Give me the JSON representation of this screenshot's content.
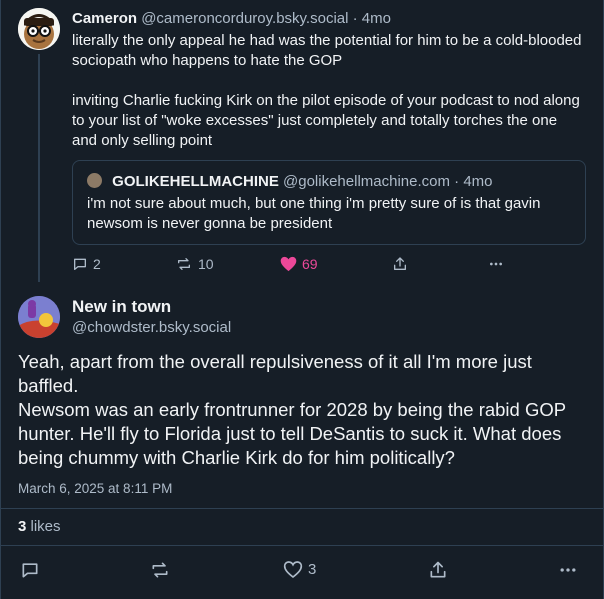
{
  "reply_post": {
    "author_name": "Cameron",
    "author_handle": "@cameroncorduroy.bsky.social",
    "separator": "·",
    "time": "4mo",
    "paragraph_1": "literally the only appeal he had was the potential for him to be a cold-blooded sociopath who happens to hate the GOP",
    "paragraph_2": "inviting Charlie fucking Kirk on the pilot episode of your podcast to nod along to your list of \"woke excesses\" just completely and totally torches the one and only selling point",
    "quote": {
      "author_name": "GOLIKEHELLMACHINE",
      "author_handle": "@golikehellmachine.com",
      "separator": "·",
      "time": "4mo",
      "text": "i'm not sure about much, but one thing i'm pretty sure of is that gavin newsom is never gonna be president"
    },
    "actions": {
      "replies": "2",
      "reposts": "10",
      "likes": "69"
    },
    "colors": {
      "like_accent": "#ec4899"
    }
  },
  "main_post": {
    "author_name": "New in town",
    "author_handle": "@chowdster.bsky.social",
    "text": "Yeah, apart from the overall repulsiveness of it all I'm more just baffled.\nNewsom was an early frontrunner for 2028 by being the rabid GOP hunter. He'll fly to Florida just to tell DeSantis to suck it. What does being chummy with Charlie Kirk do for him politically?",
    "timestamp": "March 6, 2025 at 8:11 PM",
    "likes_count": "3",
    "likes_label": "likes",
    "actions": {
      "likes": "3"
    }
  },
  "icons": [
    "reply-icon",
    "repost-icon",
    "heart-icon",
    "share-icon",
    "more-icon"
  ],
  "theme": {
    "background": "#161e27",
    "border": "#2e4052",
    "muted_text": "#aebbc9"
  }
}
